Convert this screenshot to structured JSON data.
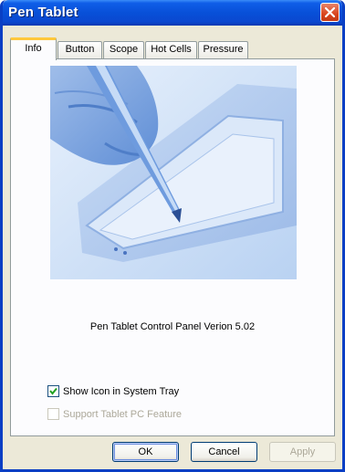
{
  "window": {
    "title": "Pen Tablet"
  },
  "tabs": [
    {
      "label": "Info",
      "active": true
    },
    {
      "label": "Button",
      "active": false
    },
    {
      "label": "Scope",
      "active": false
    },
    {
      "label": "Hot Cells",
      "active": false
    },
    {
      "label": "Pressure",
      "active": false
    }
  ],
  "info": {
    "version_text": "Pen Tablet Control Panel Verion 5.02",
    "show_icon_label": "Show Icon in System Tray",
    "show_icon_checked": true,
    "tablet_pc_label": "Support Tablet PC Feature",
    "tablet_pc_checked": false,
    "tablet_pc_enabled": false
  },
  "buttons": {
    "ok": "OK",
    "cancel": "Cancel",
    "apply": "Apply"
  },
  "colors": {
    "titlebar": "#0a48d0",
    "close": "#d9461f",
    "tab_highlight": "#ffc83c",
    "image_tint": "#a9c6ef"
  },
  "icons": {
    "close": "close-icon",
    "check": "checkmark-icon"
  }
}
